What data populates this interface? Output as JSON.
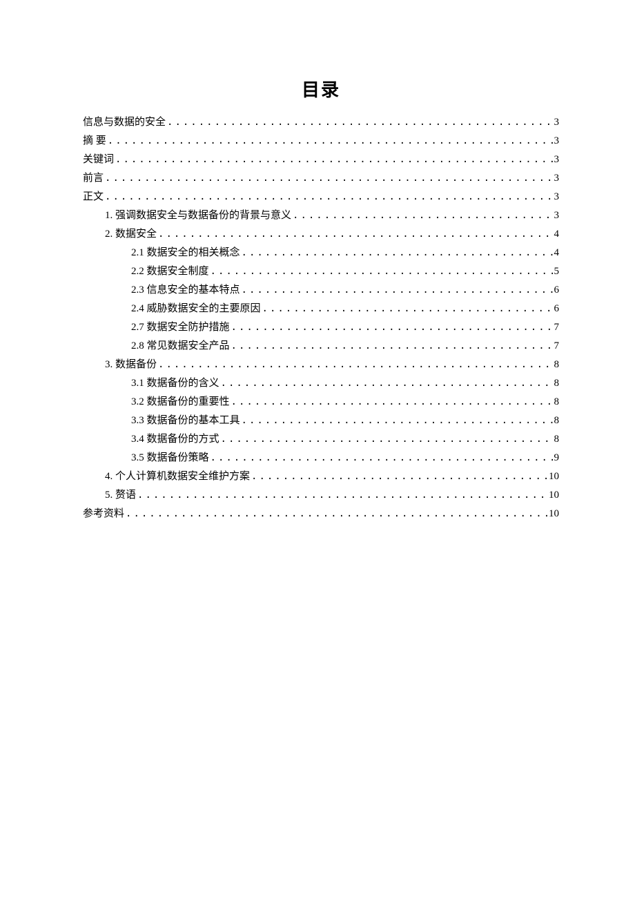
{
  "title": "目录",
  "entries": [
    {
      "level": 0,
      "text": "信息与数据的安全",
      "page": "3"
    },
    {
      "level": 0,
      "text": "摘 要",
      "page": "3"
    },
    {
      "level": 0,
      "text": "关键词",
      "page": "3"
    },
    {
      "level": 0,
      "text": "前言",
      "page": "3"
    },
    {
      "level": 0,
      "text": "正文",
      "page": "3"
    },
    {
      "level": 1,
      "text": "1. 强调数据安全与数据备份的背景与意义",
      "page": "3"
    },
    {
      "level": 1,
      "text": "2. 数据安全",
      "page": "4"
    },
    {
      "level": 2,
      "text": "2.1 数据安全的相关概念",
      "page": "4"
    },
    {
      "level": 2,
      "text": "2.2 数据安全制度",
      "page": "5"
    },
    {
      "level": 2,
      "text": "2.3 信息安全的基本特点",
      "page": "6"
    },
    {
      "level": 2,
      "text": "2.4 威胁数据安全的主要原因",
      "page": "6"
    },
    {
      "level": 2,
      "text": "2.7 数据安全防护措施",
      "page": "7"
    },
    {
      "level": 2,
      "text": "2.8 常见数据安全产品",
      "page": "7"
    },
    {
      "level": 1,
      "text": "3.  数据备份",
      "page": "8"
    },
    {
      "level": 2,
      "text": "3.1 数据备份的含义",
      "page": "8"
    },
    {
      "level": 2,
      "text": "3.2 数据备份的重要性",
      "page": "8"
    },
    {
      "level": 2,
      "text": "3.3 数据备份的基本工具",
      "page": "8"
    },
    {
      "level": 2,
      "text": "3.4 数据备份的方式",
      "page": "8"
    },
    {
      "level": 2,
      "text": "3.5 数据备份策略",
      "page": "9"
    },
    {
      "level": 1,
      "text": "4. 个人计算机数据安全维护方案",
      "page": "10"
    },
    {
      "level": 1,
      "text": "5. 赘语",
      "page": "10"
    },
    {
      "level": 0,
      "text": "参考资料",
      "page": "10"
    }
  ]
}
